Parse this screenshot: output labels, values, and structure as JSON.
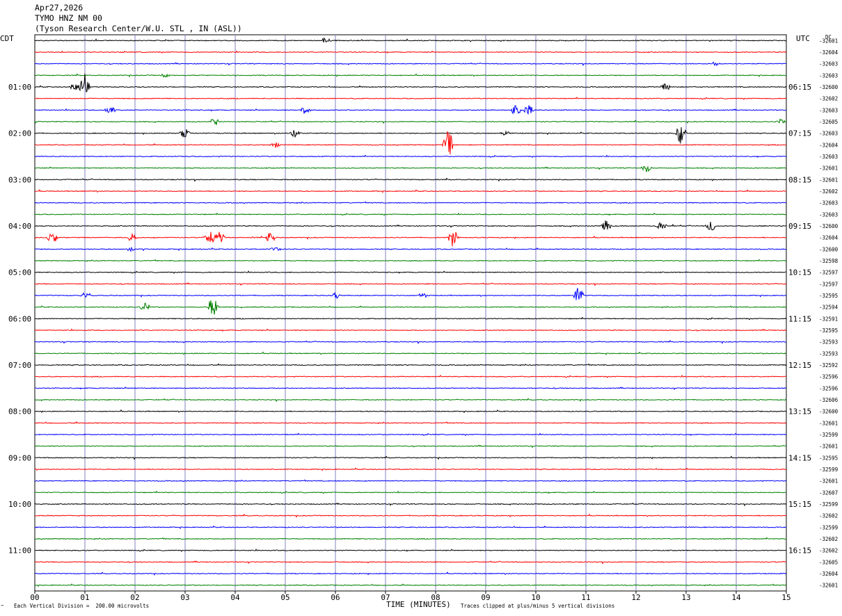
{
  "header": {
    "date": "Apr27,2026",
    "station": "TYMO HNZ NM 00",
    "location": "(Tyson Research Center/W.U. STL , IN (ASL))"
  },
  "tz_left": "CDT",
  "tz_right": "UTC",
  "dc_label": "DC",
  "footer": {
    "scale_note": "Each Vertical Division =  200.00 microvolts",
    "xlabel": "TIME (MINUTES)",
    "clip_note": "Traces clipped at plus/minus 5 vertical divisions",
    "corner_mark": "‴"
  },
  "chart_data": {
    "type": "line",
    "title": "TYMO HNZ NM 00",
    "xlabel": "TIME (MINUTES)",
    "ylabel": "",
    "xlim": [
      0,
      15
    ],
    "x_ticks": [
      "00",
      "01",
      "02",
      "03",
      "04",
      "05",
      "06",
      "07",
      "08",
      "09",
      "10",
      "11",
      "12",
      "13",
      "14",
      "15"
    ],
    "left_time_labels": [
      "01:00",
      "02:00",
      "03:00",
      "04:00",
      "05:00",
      "06:00",
      "07:00",
      "08:00",
      "09:00",
      "10:00",
      "11:00"
    ],
    "right_time_labels": [
      "06:15",
      "07:15",
      "08:15",
      "09:15",
      "10:15",
      "11:15",
      "12:15",
      "13:15",
      "14:15",
      "15:15",
      "16:15"
    ],
    "trace_colors": [
      "#000000",
      "#ff0000",
      "#0000ff",
      "#008000"
    ],
    "grid_color": "#8080c0",
    "dc_offsets": [
      "-32601",
      "-32604",
      "-32603",
      "-32603",
      "-32600",
      "-32602",
      "-32603",
      "-32605",
      "-32603",
      "-32604",
      "-32603",
      "-32601",
      "-32601",
      "-32602",
      "-32603",
      "-32603",
      "-32600",
      "-32604",
      "-32600",
      "-32598",
      "-32597",
      "-32597",
      "-32595",
      "-32594",
      "-32591",
      "-32595",
      "-32593",
      "-32593",
      "-32592",
      "-32596",
      "-32596",
      "-32606",
      "-32600",
      "-32601",
      "-32599",
      "-32601",
      "-32595",
      "-32599",
      "-32601",
      "-32607",
      "-32599",
      "-32602",
      "-32599",
      "-32602",
      "-32602",
      "-32605",
      "-32604",
      "-32601"
    ],
    "events": [
      {
        "trace": 0,
        "minute": 5.8,
        "amp": 0.15
      },
      {
        "trace": 2,
        "minute": 13.6,
        "amp": 0.12
      },
      {
        "trace": 3,
        "minute": 2.6,
        "amp": 0.15
      },
      {
        "trace": 4,
        "minute": 1.0,
        "amp": 0.9
      },
      {
        "trace": 4,
        "minute": 0.8,
        "amp": 0.25
      },
      {
        "trace": 4,
        "minute": 12.6,
        "amp": 0.2
      },
      {
        "trace": 6,
        "minute": 1.5,
        "amp": 0.25
      },
      {
        "trace": 6,
        "minute": 5.4,
        "amp": 0.25
      },
      {
        "trace": 6,
        "minute": 9.6,
        "amp": 0.3
      },
      {
        "trace": 6,
        "minute": 9.85,
        "amp": 0.35
      },
      {
        "trace": 7,
        "minute": 3.6,
        "amp": 0.2
      },
      {
        "trace": 7,
        "minute": 14.9,
        "amp": 0.15
      },
      {
        "trace": 8,
        "minute": 3.0,
        "amp": 0.3
      },
      {
        "trace": 8,
        "minute": 5.2,
        "amp": 0.3
      },
      {
        "trace": 8,
        "minute": 9.4,
        "amp": 0.15
      },
      {
        "trace": 8,
        "minute": 12.9,
        "amp": 0.65
      },
      {
        "trace": 9,
        "minute": 4.8,
        "amp": 0.2
      },
      {
        "trace": 9,
        "minute": 8.25,
        "amp": 0.8
      },
      {
        "trace": 11,
        "minute": 12.2,
        "amp": 0.25
      },
      {
        "trace": 16,
        "minute": 11.4,
        "amp": 0.35
      },
      {
        "trace": 16,
        "minute": 12.5,
        "amp": 0.25
      },
      {
        "trace": 16,
        "minute": 13.5,
        "amp": 0.3
      },
      {
        "trace": 17,
        "minute": 0.35,
        "amp": 0.35
      },
      {
        "trace": 17,
        "minute": 1.95,
        "amp": 0.25
      },
      {
        "trace": 17,
        "minute": 3.5,
        "amp": 0.55
      },
      {
        "trace": 17,
        "minute": 3.7,
        "amp": 0.35
      },
      {
        "trace": 17,
        "minute": 4.7,
        "amp": 0.3
      },
      {
        "trace": 17,
        "minute": 8.35,
        "amp": 0.55
      },
      {
        "trace": 18,
        "minute": 1.9,
        "amp": 0.12
      },
      {
        "trace": 18,
        "minute": 4.8,
        "amp": 0.15
      },
      {
        "trace": 22,
        "minute": 1.0,
        "amp": 0.15
      },
      {
        "trace": 22,
        "minute": 6.0,
        "amp": 0.2
      },
      {
        "trace": 22,
        "minute": 7.75,
        "amp": 0.15
      },
      {
        "trace": 22,
        "minute": 10.85,
        "amp": 0.5
      },
      {
        "trace": 23,
        "minute": 2.2,
        "amp": 0.25
      },
      {
        "trace": 23,
        "minute": 3.55,
        "amp": 0.55
      }
    ]
  }
}
